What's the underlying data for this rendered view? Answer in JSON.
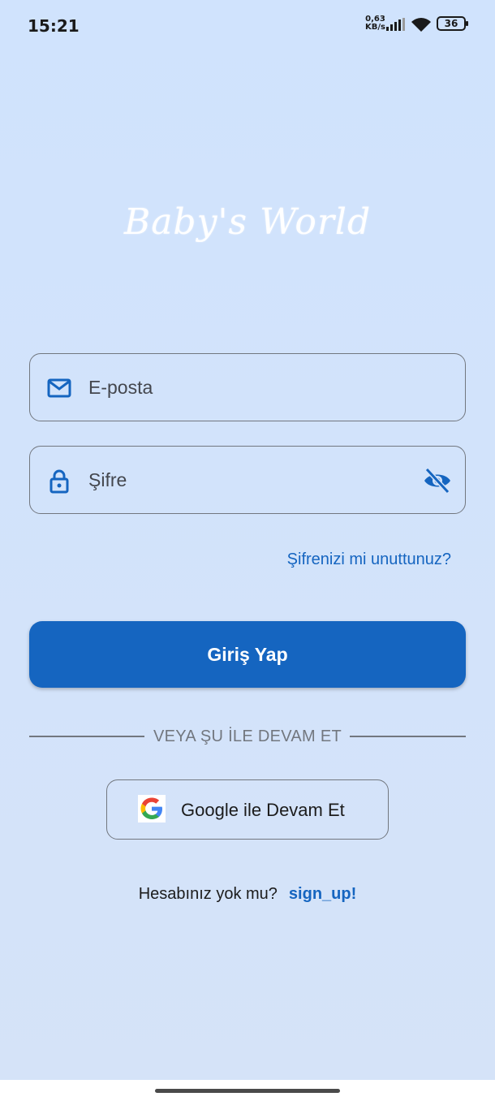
{
  "status_bar": {
    "time": "15:21",
    "net_speed_value": "0,63",
    "net_speed_unit": "KB/s",
    "battery": "36"
  },
  "app": {
    "logo_text": "Baby's World"
  },
  "form": {
    "email_placeholder": "E-posta",
    "password_placeholder": "Şifre",
    "forgot_password": "Şifrenizi mi unuttunuz?",
    "login_label": "Giriş Yap"
  },
  "alt_login": {
    "divider_text": "VEYA ŞU İLE DEVAM ET",
    "google_label": "Google ile Devam Et"
  },
  "signup": {
    "question": "Hesabınız yok mu?",
    "link": "sign_up!"
  },
  "colors": {
    "primary": "#1565c0",
    "background": "#d0e3fd",
    "outline": "#72777f"
  }
}
